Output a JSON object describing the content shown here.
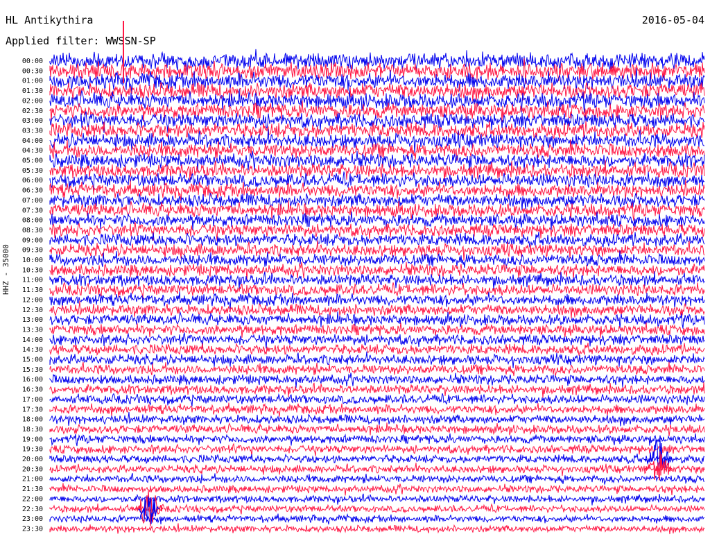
{
  "header": {
    "station": "HL Antikythira",
    "date": "2016-05-04",
    "filter": "Applied filter: WWSSN-SP"
  },
  "chart_data": {
    "type": "line",
    "title": "HL Antikythira",
    "ylabel": "HHZ - 35000",
    "colors": [
      "#0000ee",
      "#ff1744"
    ],
    "rows": [
      "00:00",
      "00:30",
      "01:00",
      "01:30",
      "02:00",
      "02:30",
      "03:00",
      "03:30",
      "04:00",
      "04:30",
      "05:00",
      "05:30",
      "06:00",
      "06:30",
      "07:00",
      "07:30",
      "08:00",
      "08:30",
      "09:00",
      "09:30",
      "10:00",
      "10:30",
      "11:00",
      "11:30",
      "12:00",
      "12:30",
      "13:00",
      "13:30",
      "14:00",
      "14:30",
      "15:00",
      "15:30",
      "16:00",
      "16:30",
      "17:00",
      "17:30",
      "18:00",
      "18:30",
      "19:00",
      "19:30",
      "20:00",
      "20:30",
      "21:00",
      "21:30",
      "22:00",
      "22:30",
      "23:00",
      "23:30"
    ],
    "events": [
      {
        "row": "22:30",
        "label": "quake-1"
      },
      {
        "row": "20:00",
        "label": "quake-2"
      },
      {
        "row": "00:00",
        "label": "spike"
      }
    ]
  }
}
